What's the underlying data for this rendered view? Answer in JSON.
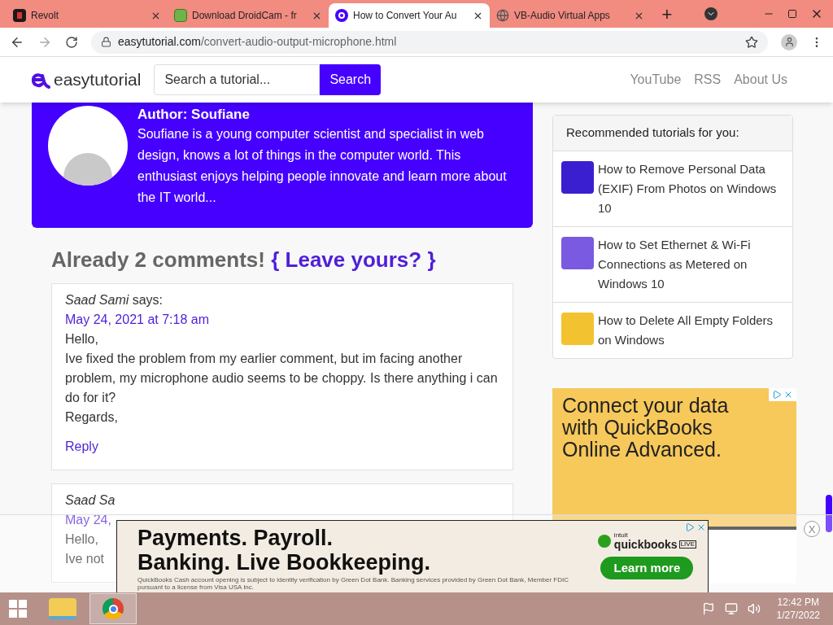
{
  "browser": {
    "tabs": [
      {
        "title": "Revolt",
        "selected": false
      },
      {
        "title": "Download DroidCam - fr",
        "selected": false
      },
      {
        "title": "How to Convert Your Au",
        "selected": true
      },
      {
        "title": "VB-Audio Virtual Apps",
        "selected": false
      }
    ],
    "new_tab": "+",
    "address": {
      "domain": "easytutorial.com",
      "path": "/convert-audio-output-microphone.html"
    }
  },
  "site_header": {
    "logo": "easytutorial",
    "search": {
      "placeholder": "Search a tutorial...",
      "button": "Search"
    },
    "nav": [
      "YouTube",
      "RSS",
      "About Us"
    ]
  },
  "author": {
    "heading": "Author: Soufiane",
    "bio": "Soufiane is a young computer scientist and specialist in web design, knows a lot of things in the computer world. This enthusiast enjoys helping people innovate and learn more about the IT world..."
  },
  "comments_heading": {
    "count_text": "Already 2 comments!",
    "link": "{ Leave yours? }"
  },
  "comments": [
    {
      "author": "Saad Sami",
      "says": "says:",
      "date": "May 24, 2021 at 7:18 am",
      "lines": [
        "Hello,",
        "Ive fixed the problem from my earlier comment, but im facing another problem, my microphone audio seems to be choppy. Is there anything i can do for it?",
        "Regards,"
      ],
      "reply": "Reply"
    },
    {
      "author": "Saad Sa",
      "date": "May 24,",
      "lines": [
        "Hello,",
        "Ive not"
      ]
    }
  ],
  "sidebar": {
    "title": "Recommended tutorials for you:",
    "items": [
      {
        "title": "How to Remove Personal Data (EXIF) From Photos on Windows 10"
      },
      {
        "title": "How to Set Ethernet & Wi-Fi Connections as Metered on Windows 10"
      },
      {
        "title": "How to Delete All Empty Folders on Windows"
      }
    ]
  },
  "side_ad": {
    "headline": "Connect your data with QuickBooks Online Advanced."
  },
  "bottom_ad": {
    "headline_1": "Payments. Payroll.",
    "headline_2": "Banking. Live Bookkeeping.",
    "brand_small": "intuit",
    "brand": "quickbooks",
    "brand_badge": "LIVE",
    "cta": "Learn more",
    "fine_print": "QuickBooks Cash account opening is subject to identity verification by Green Dot Bank. Banking services provided by Green Dot Bank, Member FDIC pursuant to a license from Visa USA Inc.",
    "close": "X"
  },
  "taskbar": {
    "time": "12:42 PM",
    "date": "1/27/2022"
  }
}
